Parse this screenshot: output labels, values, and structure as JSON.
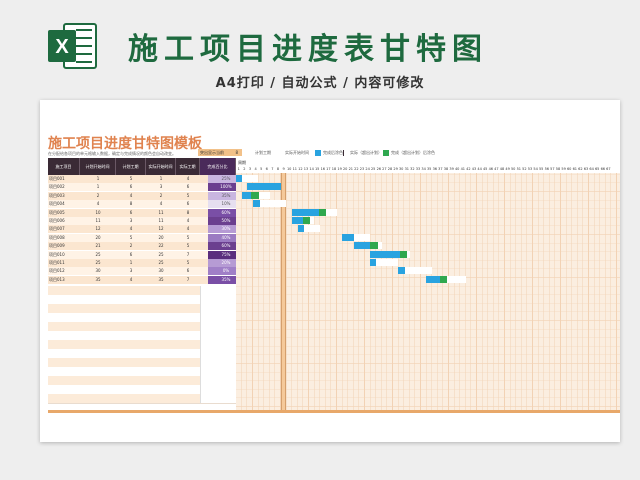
{
  "banner": {
    "title": "施工项目进度表甘特图",
    "subtitle": "A4打印 / 自动公式 / 内容可修改",
    "logo_letter": "X",
    "logo_color": "#1e6a3f"
  },
  "sheet": {
    "title": "施工项目进度甘特图模板",
    "note": "在分配给各项目的单元格输入数据，确定与完成情况的颜色会自动改变。",
    "current_week_label": "突出显示当前",
    "current_week_value": "8",
    "legend": {
      "plan_label": "计划工期",
      "actual_start_label": "实际开始时间",
      "complete_label": "完成后涂色",
      "actual_label": "实际（超出计划）",
      "complete2_label": "完成（超出计划）后涂色"
    },
    "columns": [
      "施工项目",
      "计划开始时间",
      "计划工期",
      "实际开始时间",
      "实际工期",
      "完成百分比"
    ],
    "rows": [
      {
        "name": "项目001",
        "plan_start": "1",
        "plan_dur": "5",
        "act_start": "1",
        "act_dur": "4",
        "pct": "25%"
      },
      {
        "name": "项目002",
        "plan_start": "1",
        "plan_dur": "6",
        "act_start": "3",
        "act_dur": "6",
        "pct": "100%"
      },
      {
        "name": "项目003",
        "plan_start": "2",
        "plan_dur": "4",
        "act_start": "2",
        "act_dur": "5",
        "pct": "35%"
      },
      {
        "name": "项目004",
        "plan_start": "4",
        "plan_dur": "8",
        "act_start": "4",
        "act_dur": "6",
        "pct": "10%"
      },
      {
        "name": "项目005",
        "plan_start": "10",
        "plan_dur": "6",
        "act_start": "11",
        "act_dur": "8",
        "pct": "60%"
      },
      {
        "name": "项目006",
        "plan_start": "11",
        "plan_dur": "3",
        "act_start": "11",
        "act_dur": "4",
        "pct": "50%"
      },
      {
        "name": "项目007",
        "plan_start": "12",
        "plan_dur": "4",
        "act_start": "12",
        "act_dur": "4",
        "pct": "30%"
      },
      {
        "name": "项目008",
        "plan_start": "20",
        "plan_dur": "5",
        "act_start": "20",
        "act_dur": "5",
        "pct": "40%"
      },
      {
        "name": "项目009",
        "plan_start": "21",
        "plan_dur": "2",
        "act_start": "22",
        "act_dur": "5",
        "pct": "60%"
      },
      {
        "name": "项目010",
        "plan_start": "25",
        "plan_dur": "6",
        "act_start": "25",
        "act_dur": "7",
        "pct": "75%"
      },
      {
        "name": "项目011",
        "plan_start": "25",
        "plan_dur": "1",
        "act_start": "25",
        "act_dur": "5",
        "pct": "20%"
      },
      {
        "name": "项目012",
        "plan_start": "30",
        "plan_dur": "3",
        "act_start": "30",
        "act_dur": "6",
        "pct": "0%"
      },
      {
        "name": "项目013",
        "plan_start": "35",
        "plan_dur": "4",
        "act_start": "35",
        "act_dur": "7",
        "pct": "35%"
      }
    ],
    "gantt_header_label": "周期",
    "day_numbers": [
      "1",
      "2",
      "3",
      "4",
      "5",
      "6",
      "7",
      "8",
      "9",
      "10",
      "11",
      "12",
      "13",
      "14",
      "15",
      "16",
      "17",
      "18",
      "19",
      "20",
      "21",
      "22",
      "23",
      "24",
      "25",
      "26",
      "27",
      "28",
      "29",
      "30",
      "31",
      "32",
      "33",
      "34",
      "35",
      "36",
      "37",
      "38",
      "39",
      "40",
      "41",
      "42",
      "43",
      "44",
      "45",
      "46",
      "47",
      "48",
      "49",
      "50",
      "51",
      "52",
      "53",
      "54",
      "55",
      "56",
      "57",
      "58",
      "59",
      "60",
      "61",
      "62",
      "63",
      "64",
      "65",
      "66",
      "67"
    ],
    "colors": {
      "header_dark": "#3a2a35",
      "plan_purple": "#6b3f8f",
      "blue_bar": "#29a3e0",
      "green_bar": "#2fa84f",
      "title_orange": "#e0834f"
    }
  }
}
